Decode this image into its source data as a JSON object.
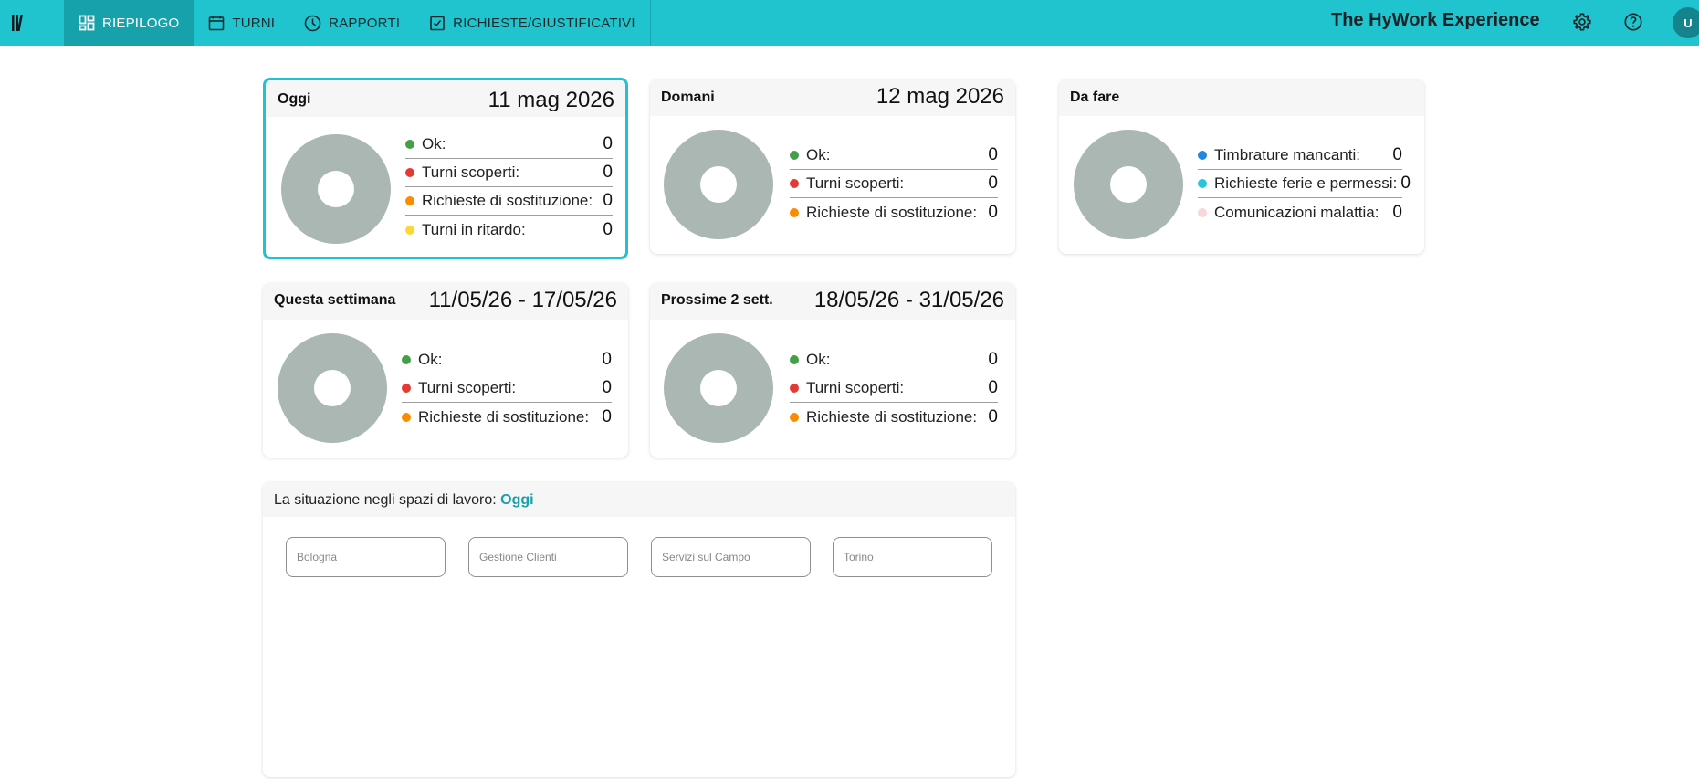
{
  "nav": {
    "tabs": [
      {
        "label": "RIEPILOGO",
        "icon": "dashboard-icon"
      },
      {
        "label": "TURNI",
        "icon": "calendar-icon"
      },
      {
        "label": "RAPPORTI",
        "icon": "clock-icon"
      },
      {
        "label": "RICHIESTE/GIUSTIFICATIVI",
        "icon": "clipboard-check-icon"
      }
    ],
    "active": "RIEPILOGO"
  },
  "header": {
    "title": "The HyWork Experience",
    "avatar_initial": "U",
    "icons": [
      "settings-icon",
      "help-icon"
    ]
  },
  "colors": {
    "accent": "#1fc4cf",
    "accent_dark": "#17a1ab",
    "donut": "#aab7b3",
    "ok": "#43a047",
    "uncovered": "#e53935",
    "substitution": "#fb8c00",
    "late": "#fdd835",
    "missing_clock": "#1e88e5",
    "leave": "#26c6da",
    "sickness": "#f8d7da"
  },
  "cards": {
    "today": {
      "label": "Oggi",
      "date": "11 mag 2026",
      "rows": [
        {
          "label": "Ok:",
          "value": "0"
        },
        {
          "label": "Turni scoperti:",
          "value": "0"
        },
        {
          "label": "Richieste di sostituzione:",
          "value": "0"
        },
        {
          "label": "Turni in ritardo:",
          "value": "0"
        }
      ]
    },
    "tomorrow": {
      "label": "Domani",
      "date": "12 mag 2026",
      "rows": [
        {
          "label": "Ok:",
          "value": "0"
        },
        {
          "label": "Turni scoperti:",
          "value": "0"
        },
        {
          "label": "Richieste di sostituzione:",
          "value": "0"
        }
      ]
    },
    "todo": {
      "label": "Da fare",
      "rows": [
        {
          "label": "Timbrature mancanti:",
          "value": "0"
        },
        {
          "label": "Richieste ferie e permessi:",
          "value": "0"
        },
        {
          "label": "Comunicazioni malattia:",
          "value": "0"
        }
      ]
    },
    "week": {
      "label": "Questa settimana",
      "date": "11/05/26 - 17/05/26",
      "rows": [
        {
          "label": "Ok:",
          "value": "0"
        },
        {
          "label": "Turni scoperti:",
          "value": "0"
        },
        {
          "label": "Richieste di sostituzione:",
          "value": "0"
        }
      ]
    },
    "next2": {
      "label": "Prossime 2 sett.",
      "date": "18/05/26 - 31/05/26",
      "rows": [
        {
          "label": "Ok:",
          "value": "0"
        },
        {
          "label": "Turni scoperti:",
          "value": "0"
        },
        {
          "label": "Richieste di sostituzione:",
          "value": "0"
        }
      ]
    }
  },
  "workspaces": {
    "title": "La situazione negli spazi di lavoro:",
    "period": "Oggi",
    "fields": [
      "Bologna",
      "Gestione Clienti",
      "Servizi sul Campo",
      "Torino"
    ]
  }
}
